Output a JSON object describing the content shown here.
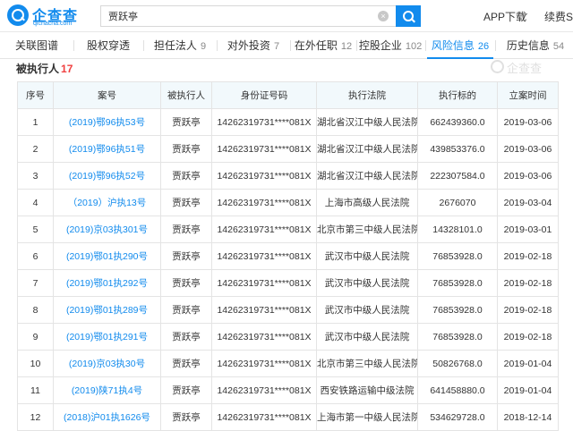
{
  "header": {
    "logo_text": "企查查",
    "logo_sub": "qichacha.com",
    "search_value": "贾跃亭",
    "app_download": "APP下载",
    "user": "续费SV",
    "colors": {
      "brand": "#128bed"
    }
  },
  "tabs": [
    {
      "label": "关联图谱",
      "count": ""
    },
    {
      "label": "股权穿透",
      "count": ""
    },
    {
      "label": "担任法人",
      "count": "9"
    },
    {
      "label": "对外投资",
      "count": "7"
    },
    {
      "label": "在外任职",
      "count": "12"
    },
    {
      "label": "控股企业",
      "count": "102"
    },
    {
      "label": "风险信息",
      "count": "26"
    },
    {
      "label": "历史信息",
      "count": "54"
    }
  ],
  "section": {
    "title": "被执行人",
    "count": "17",
    "watermark": "企查查"
  },
  "table": {
    "headers": [
      "序号",
      "案号",
      "被执行人",
      "身份证号码",
      "执行法院",
      "执行标的",
      "立案时间"
    ],
    "rows": [
      [
        "1",
        "(2019)鄂96执53号",
        "贾跃亭",
        "14262319731****081X",
        "湖北省汉江中级人民法院",
        "662439360.0",
        "2019-03-06"
      ],
      [
        "2",
        "(2019)鄂96执51号",
        "贾跃亭",
        "14262319731****081X",
        "湖北省汉江中级人民法院",
        "439853376.0",
        "2019-03-06"
      ],
      [
        "3",
        "(2019)鄂96执52号",
        "贾跃亭",
        "14262319731****081X",
        "湖北省汉江中级人民法院",
        "222307584.0",
        "2019-03-06"
      ],
      [
        "4",
        "（2019）沪执13号",
        "贾跃亭",
        "14262319731****081X",
        "上海市高级人民法院",
        "2676070",
        "2019-03-04"
      ],
      [
        "5",
        "(2019)京03执301号",
        "贾跃亭",
        "14262319731****081X",
        "北京市第三中级人民法院",
        "14328101.0",
        "2019-03-01"
      ],
      [
        "6",
        "(2019)鄂01执290号",
        "贾跃亭",
        "14262319731****081X",
        "武汉市中级人民法院",
        "76853928.0",
        "2019-02-18"
      ],
      [
        "7",
        "(2019)鄂01执292号",
        "贾跃亭",
        "14262319731****081X",
        "武汉市中级人民法院",
        "76853928.0",
        "2019-02-18"
      ],
      [
        "8",
        "(2019)鄂01执289号",
        "贾跃亭",
        "14262319731****081X",
        "武汉市中级人民法院",
        "76853928.0",
        "2019-02-18"
      ],
      [
        "9",
        "(2019)鄂01执291号",
        "贾跃亭",
        "14262319731****081X",
        "武汉市中级人民法院",
        "76853928.0",
        "2019-02-18"
      ],
      [
        "10",
        "(2019)京03执30号",
        "贾跃亭",
        "14262319731****081X",
        "北京市第三中级人民法院",
        "50826768.0",
        "2019-01-04"
      ],
      [
        "11",
        "(2019)陕71执4号",
        "贾跃亭",
        "14262319731****081X",
        "西安铁路运输中级法院",
        "641458880.0",
        "2019-01-04"
      ],
      [
        "12",
        "(2018)沪01执1626号",
        "贾跃亭",
        "14262319731****081X",
        "上海市第一中级人民法院",
        "534629728.0",
        "2018-12-14"
      ]
    ]
  }
}
